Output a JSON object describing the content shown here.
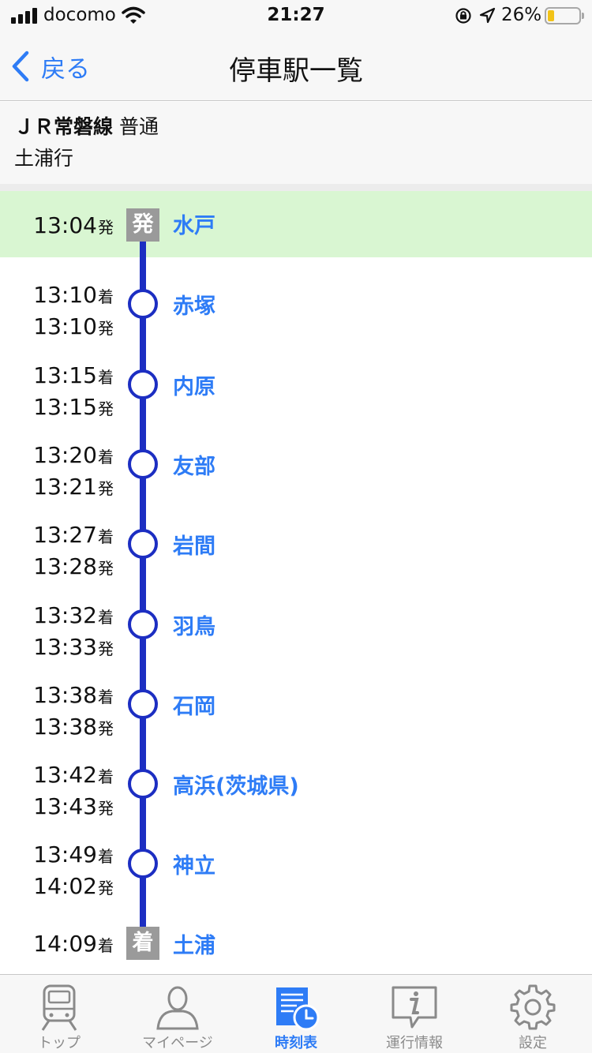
{
  "status": {
    "carrier": "docomo",
    "time": "21:27",
    "battery_pct": "26%"
  },
  "nav": {
    "back_label": "戻る",
    "title": "停車駅一覧"
  },
  "route": {
    "line": "ＪＲ常磐線",
    "type": "普通",
    "destination": "土浦行"
  },
  "marks": {
    "arr": "着",
    "dep": "発"
  },
  "stops": [
    {
      "arr": "",
      "dep": "13:04",
      "station": "水戸",
      "kind": "origin",
      "badge": "発"
    },
    {
      "arr": "13:10",
      "dep": "13:10",
      "station": "赤塚",
      "kind": "mid"
    },
    {
      "arr": "13:15",
      "dep": "13:15",
      "station": "内原",
      "kind": "mid"
    },
    {
      "arr": "13:20",
      "dep": "13:21",
      "station": "友部",
      "kind": "mid"
    },
    {
      "arr": "13:27",
      "dep": "13:28",
      "station": "岩間",
      "kind": "mid"
    },
    {
      "arr": "13:32",
      "dep": "13:33",
      "station": "羽鳥",
      "kind": "mid"
    },
    {
      "arr": "13:38",
      "dep": "13:38",
      "station": "石岡",
      "kind": "mid"
    },
    {
      "arr": "13:42",
      "dep": "13:43",
      "station": "高浜(茨城県)",
      "kind": "mid"
    },
    {
      "arr": "13:49",
      "dep": "14:02",
      "station": "神立",
      "kind": "mid"
    },
    {
      "arr": "14:09",
      "dep": "",
      "station": "土浦",
      "kind": "terminal",
      "badge": "着"
    }
  ],
  "tabs": [
    {
      "label": "トップ",
      "icon": "train-icon"
    },
    {
      "label": "マイページ",
      "icon": "user-icon"
    },
    {
      "label": "時刻表",
      "icon": "timetable-icon",
      "active": true
    },
    {
      "label": "運行情報",
      "icon": "info-icon"
    },
    {
      "label": "設定",
      "icon": "gear-icon"
    }
  ],
  "colors": {
    "accent": "#2e7cf6",
    "route_line": "#1c2ec2",
    "origin_highlight": "#d9f6d2",
    "badge": "#9a9a9a"
  }
}
